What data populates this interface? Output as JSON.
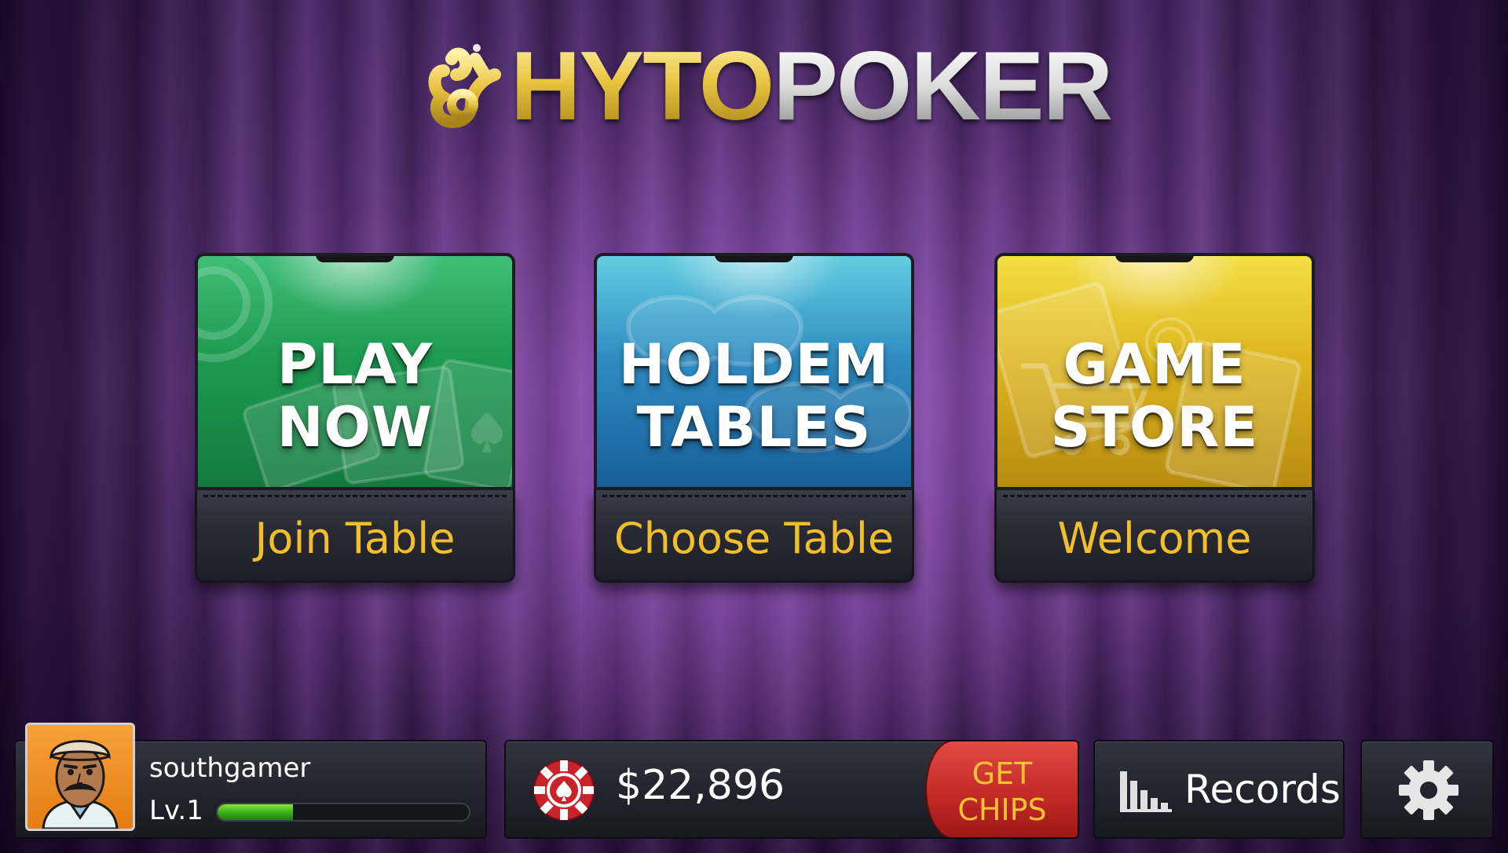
{
  "app": {
    "logo_part1": "HYTO",
    "logo_part2": "POKER"
  },
  "cards": [
    {
      "line1": "PLAY",
      "line2": "NOW",
      "label": "Join Table",
      "color": "#1d9a52",
      "icon": "poker-chip-and-cards"
    },
    {
      "line1": "HOLDEM",
      "line2": "TABLES",
      "label": "Choose Table",
      "color": "#2f8cc2",
      "icon": "poker-table"
    },
    {
      "line1": "GAME",
      "line2": "STORE",
      "label": "Welcome",
      "color": "#ddb61f",
      "icon": "shopping-cart-and-cards"
    }
  ],
  "player": {
    "username": "southgamer",
    "level": "Lv.1",
    "xp_progress": 0.3,
    "avatar": "cartoon-man-with-cap"
  },
  "wallet": {
    "balance": "$22,896",
    "get_chips_line1": "GET",
    "get_chips_line2": "CHIPS",
    "chip_icon": "poker-chip-icon"
  },
  "records": {
    "label": "Records",
    "icon": "bar-chart-icon"
  },
  "settings": {
    "icon": "gear-icon"
  },
  "colors": {
    "accent_gold": "#f1bf2c",
    "get_chips_red": "#c42a28",
    "xp_green": "#3bb319",
    "background_purple": "#5a2e7a"
  }
}
